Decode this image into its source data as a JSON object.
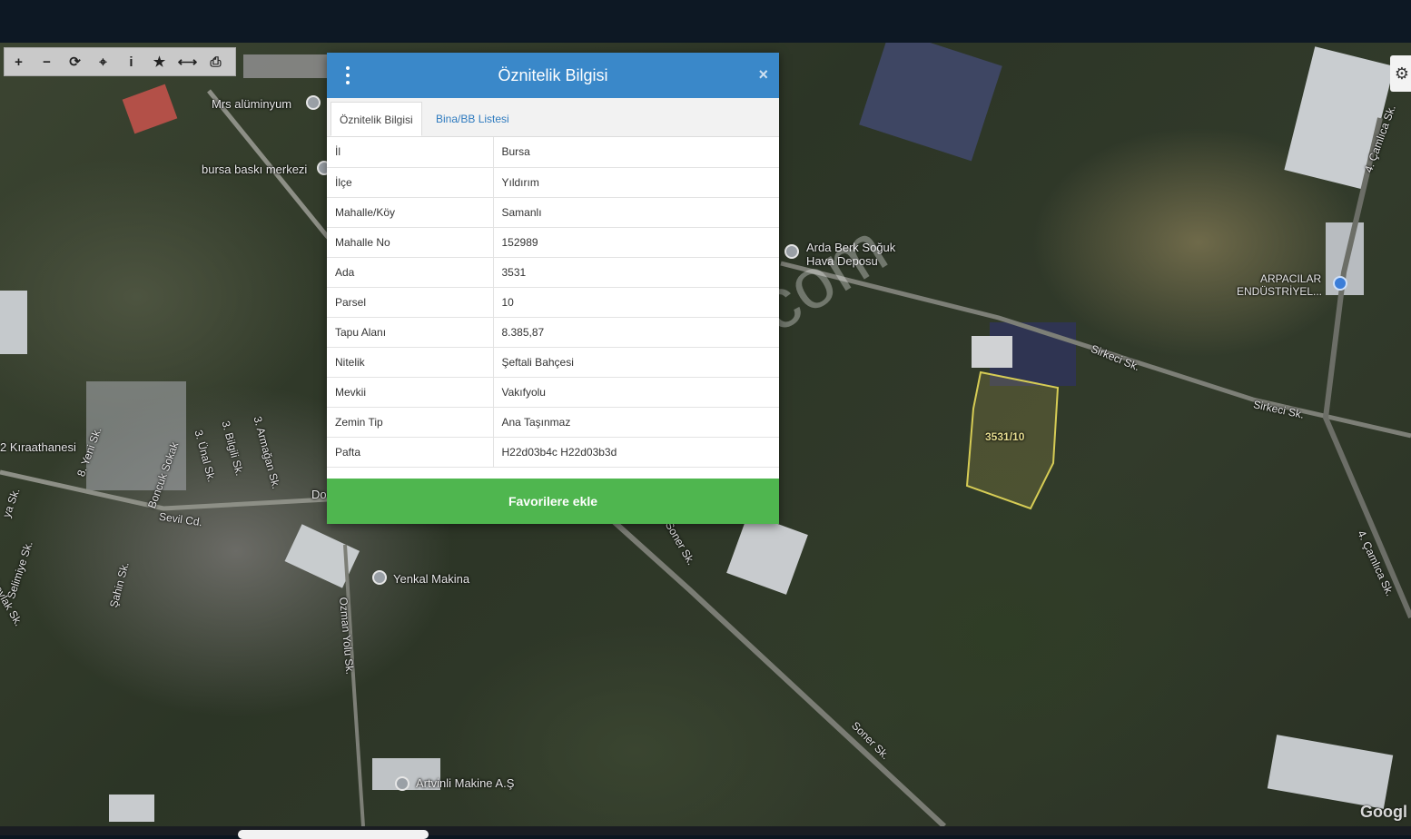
{
  "toolbar": {
    "buttons": [
      {
        "icon": "zoom-in-icon",
        "glyph": "+"
      },
      {
        "icon": "zoom-out-icon",
        "glyph": "−"
      },
      {
        "icon": "refresh-icon",
        "glyph": "⟳"
      },
      {
        "icon": "locate-icon",
        "glyph": "⌖"
      },
      {
        "icon": "info-icon",
        "glyph": "i"
      },
      {
        "icon": "star-icon",
        "glyph": "★"
      },
      {
        "icon": "measure-icon",
        "glyph": "⟷"
      },
      {
        "icon": "print-icon",
        "glyph": "⎙"
      }
    ]
  },
  "map": {
    "labels": {
      "mrs_aluminyum": "Mrs alüminyum",
      "bursa_baski": "bursa baskı merkezi",
      "arda_berk_1": "Arda Berk Soğuk",
      "arda_berk_2": "Hava Deposu",
      "arpacilar_1": "ARPACILAR",
      "arpacilar_2": "ENDÜSTRİYEL...",
      "sirkeci_1": "Sirkeci Sk.",
      "sirkeci_2": "Sirkeci Sk.",
      "camlica_1": "4. Çamlıca Sk.",
      "camlica_2": "4. Çamlıca Sk.",
      "kiraathanesi": "2 Kıraathanesi",
      "yeni_sk": "8. Yeni Sk.",
      "boncuk": "Boncuk Sokak",
      "unal": "3. Ünal Sk.",
      "bilgili": "3. Bilgili Sk.",
      "armagan": "3. Armağan Sk.",
      "sevil": "Sevil Cd.",
      "selimiye": "Selimiye Sk.",
      "leylak": "Leylak Sk.",
      "sahin": "Şahin Sk.",
      "ozman_yolu": "Ozman Yolu Sk.",
      "yenkal": "Yenkal Makina",
      "soner_1": "Soner Sk.",
      "soner_2": "Soner Sk.",
      "artvinli": "Artvinli Makine A.Ş",
      "parcel": "3531/10",
      "do": "Do",
      "ya_sk": "ya Sk."
    },
    "watermark": "emlakjet.com",
    "google": "Googl"
  },
  "dialog": {
    "title": "Öznitelik Bilgisi",
    "tabs": [
      "Öznitelik Bilgisi",
      "Bina/BB Listesi"
    ],
    "rows": [
      {
        "key": "İl",
        "value": "Bursa"
      },
      {
        "key": "İlçe",
        "value": "Yıldırım"
      },
      {
        "key": "Mahalle/Köy",
        "value": "Samanlı"
      },
      {
        "key": "Mahalle No",
        "value": "152989"
      },
      {
        "key": "Ada",
        "value": "3531"
      },
      {
        "key": "Parsel",
        "value": "10"
      },
      {
        "key": "Tapu Alanı",
        "value": "8.385,87"
      },
      {
        "key": "Nitelik",
        "value": "Şeftali Bahçesi"
      },
      {
        "key": "Mevkii",
        "value": "Vakıfyolu"
      },
      {
        "key": "Zemin Tip",
        "value": "Ana Taşınmaz"
      },
      {
        "key": "Pafta",
        "value": "H22d03b4c H22d03b3d"
      }
    ],
    "favorite_button": "Favorilere ekle",
    "close_glyph": "×"
  }
}
